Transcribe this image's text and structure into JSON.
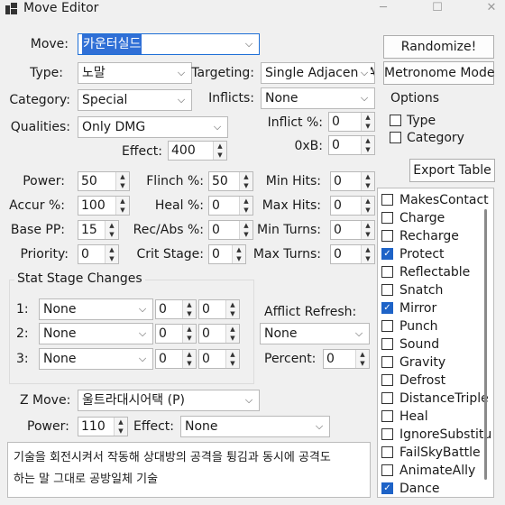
{
  "window": {
    "title": "Move Editor",
    "minimize": "─",
    "maximize": "☐",
    "close": "✕"
  },
  "move": {
    "label": "Move:",
    "value": "카운터실드"
  },
  "type": {
    "label": "Type:",
    "value": "노말"
  },
  "category": {
    "label": "Category:",
    "value": "Special"
  },
  "qualities": {
    "label": "Qualities:",
    "value": "Only DMG"
  },
  "effect": {
    "label": "Effect:",
    "value": "400"
  },
  "targeting": {
    "label": "Targeting:",
    "value": "Single Adjacent A"
  },
  "inflicts": {
    "label": "Inflicts:",
    "value": "None"
  },
  "inflict_pct": {
    "label": "Inflict %:",
    "value": "0"
  },
  "oxb": {
    "label": "0xB:",
    "value": "0"
  },
  "buttons": {
    "randomize": "Randomize!",
    "metronome": "Metronome Mode",
    "export": "Export Table"
  },
  "options": {
    "title": "Options",
    "type": "Type",
    "category": "Category"
  },
  "stats": {
    "power": {
      "label": "Power:",
      "value": "50"
    },
    "accur": {
      "label": "Accur %:",
      "value": "100"
    },
    "base_pp": {
      "label": "Base PP:",
      "value": "15"
    },
    "priority": {
      "label": "Priority:",
      "value": "0"
    },
    "flinch": {
      "label": "Flinch %:",
      "value": "50"
    },
    "heal": {
      "label": "Heal %:",
      "value": "0"
    },
    "recabs": {
      "label": "Rec/Abs %:",
      "value": "0"
    },
    "crit": {
      "label": "Crit Stage:",
      "value": "0"
    },
    "min_hits": {
      "label": "Min Hits:",
      "value": "0"
    },
    "max_hits": {
      "label": "Max Hits:",
      "value": "0"
    },
    "min_turns": {
      "label": "Min Turns:",
      "value": "0"
    },
    "max_turns": {
      "label": "Max Turns:",
      "value": "0"
    }
  },
  "stat_stage": {
    "title": "Stat Stage Changes",
    "rows": [
      {
        "label": "1:",
        "stat": "None",
        "a": "0",
        "b": "0"
      },
      {
        "label": "2:",
        "stat": "None",
        "a": "0",
        "b": "0"
      },
      {
        "label": "3:",
        "stat": "None",
        "a": "0",
        "b": "0"
      }
    ]
  },
  "afflict": {
    "label": "Afflict Refresh:",
    "value": "None",
    "percent_label": "Percent:",
    "percent": "0"
  },
  "zmove": {
    "label": "Z Move:",
    "value": "울트라대시어택 (P)",
    "power_label": "Power:",
    "power": "110",
    "effect_label": "Effect:",
    "effect": "None"
  },
  "description": {
    "line1": "기술을 회전시켜서 작동해 상대방의 공격을 튕김과 동시에 공격도",
    "line2": "하는 말 그대로 공방일체 기술"
  },
  "flags": [
    {
      "label": "MakesContact",
      "checked": false
    },
    {
      "label": "Charge",
      "checked": false
    },
    {
      "label": "Recharge",
      "checked": false
    },
    {
      "label": "Protect",
      "checked": true
    },
    {
      "label": "Reflectable",
      "checked": false
    },
    {
      "label": "Snatch",
      "checked": false
    },
    {
      "label": "Mirror",
      "checked": true
    },
    {
      "label": "Punch",
      "checked": false
    },
    {
      "label": "Sound",
      "checked": false
    },
    {
      "label": "Gravity",
      "checked": false
    },
    {
      "label": "Defrost",
      "checked": false
    },
    {
      "label": "DistanceTriple",
      "checked": false
    },
    {
      "label": "Heal",
      "checked": false
    },
    {
      "label": "IgnoreSubstitu",
      "checked": false
    },
    {
      "label": "FailSkyBattle",
      "checked": false
    },
    {
      "label": "AnimateAlly",
      "checked": false
    },
    {
      "label": "Dance",
      "checked": true
    }
  ]
}
